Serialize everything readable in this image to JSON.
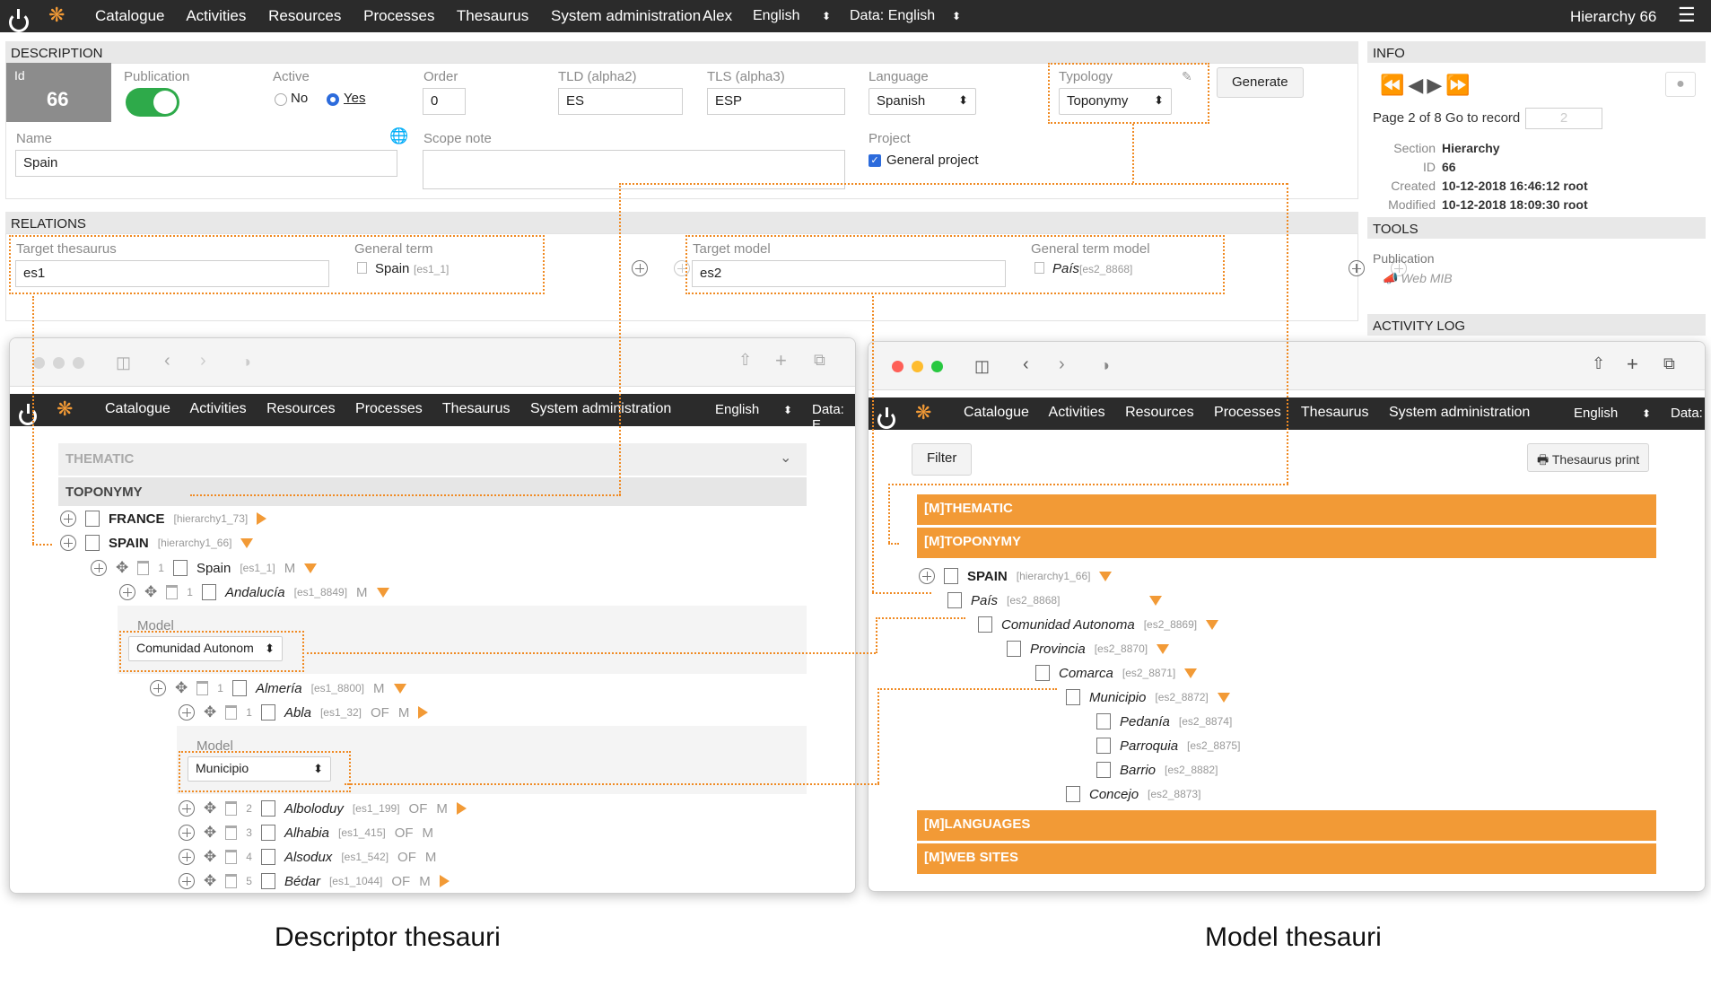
{
  "nav": {
    "menu": [
      "Catalogue",
      "Activities",
      "Resources",
      "Processes",
      "Thesaurus",
      "System administration"
    ],
    "user": "Alex",
    "lang": "English",
    "data_lang": "Data: English",
    "right_title": "Hierarchy 66"
  },
  "description": {
    "header": "DESCRIPTION",
    "id_label": "Id",
    "id_value": "66",
    "publication_label": "Publication",
    "active_label": "Active",
    "active_no": "No",
    "active_yes": "Yes",
    "order_label": "Order",
    "order_value": "0",
    "tld_label": "TLD (alpha2)",
    "tld_value": "ES",
    "tls_label": "TLS (alpha3)",
    "tls_value": "ESP",
    "language_label": "Language",
    "language_value": "Spanish",
    "typology_label": "Typology",
    "typology_value": "Toponymy",
    "generate_label": "Generate",
    "name_label": "Name",
    "name_value": "Spain",
    "scope_label": "Scope note",
    "project_label": "Project",
    "project_value": "General project"
  },
  "relations": {
    "header": "RELATIONS",
    "target_thesaurus_label": "Target thesaurus",
    "target_thesaurus_value": "es1",
    "general_term_label": "General term",
    "general_term_value": "Spain",
    "general_term_code": "[es1_1]",
    "target_model_label": "Target model",
    "target_model_value": "es2",
    "general_term_model_label": "General term model",
    "general_term_model_value": "País",
    "general_term_model_code": "[es2_8868]"
  },
  "info": {
    "header": "INFO",
    "page_text": "Page 2 of 8 Go to record",
    "record_placeholder": "2",
    "section_label": "Section",
    "section_value": "Hierarchy",
    "id_label": "ID",
    "id_value": "66",
    "created_label": "Created",
    "created_value": "10-12-2018 16:46:12 root",
    "modified_label": "Modified",
    "modified_value": "10-12-2018 18:09:30 root",
    "tools_header": "TOOLS",
    "publication_label": "Publication",
    "web_mib": "Web MIB",
    "activity_header": "ACTIVITY LOG"
  },
  "left_window": {
    "nav_menu": [
      "Catalogue",
      "Activities",
      "Resources",
      "Processes",
      "Thesaurus",
      "System administration"
    ],
    "nav_lang": "English",
    "nav_data": "Data: E",
    "thematic": "THEMATIC",
    "toponymy": "TOPONYMY",
    "rows": [
      {
        "name": "FRANCE",
        "code": "[hierarchy1_73]"
      },
      {
        "name": "SPAIN",
        "code": "[hierarchy1_66]"
      },
      {
        "num": "1",
        "name": "Spain",
        "code": "[es1_1]",
        "m": "M"
      },
      {
        "num": "1",
        "name": "Andalucía",
        "code": "[es1_8849]",
        "m": "M"
      },
      {
        "num": "1",
        "name": "Almería",
        "code": "[es1_8800]",
        "m": "M"
      },
      {
        "num": "1",
        "name": "Abla",
        "code": "[es1_32]",
        "of": "OF",
        "m": "M"
      },
      {
        "num": "2",
        "name": "Alboloduy",
        "code": "[es1_199]",
        "of": "OF",
        "m": "M"
      },
      {
        "num": "3",
        "name": "Alhabia",
        "code": "[es1_415]",
        "of": "OF",
        "m": "M"
      },
      {
        "num": "4",
        "name": "Alsodux",
        "code": "[es1_542]",
        "of": "OF",
        "m": "M"
      },
      {
        "num": "5",
        "name": "Bédar",
        "code": "[es1_1044]",
        "of": "OF",
        "m": "M"
      }
    ],
    "model_label": "Model",
    "model1_value": "Comunidad Autonom",
    "model2_value": "Municipio"
  },
  "right_window": {
    "nav_menu": [
      "Catalogue",
      "Activities",
      "Resources",
      "Processes",
      "Thesaurus",
      "System administration"
    ],
    "nav_lang": "English",
    "nav_data": "Data:",
    "filter": "Filter",
    "print": "Thesaurus print",
    "bars": [
      "[M]THEMATIC",
      "[M]TOPONYMY",
      "[M]LANGUAGES",
      "[M]WEB SITES"
    ],
    "tree": [
      {
        "name": "SPAIN",
        "code": "[hierarchy1_66]"
      },
      {
        "name": "País",
        "code": "[es2_8868]"
      },
      {
        "name": "Comunidad Autonoma",
        "code": "[es2_8869]"
      },
      {
        "name": "Provincia",
        "code": "[es2_8870]"
      },
      {
        "name": "Comarca",
        "code": "[es2_8871]"
      },
      {
        "name": "Municipio",
        "code": "[es2_8872]"
      },
      {
        "name": "Pedanía",
        "code": "[es2_8874]"
      },
      {
        "name": "Parroquia",
        "code": "[es2_8875]"
      },
      {
        "name": "Barrio",
        "code": "[es2_8882]"
      },
      {
        "name": "Concejo",
        "code": "[es2_8873]"
      }
    ]
  },
  "captions": {
    "left": "Descriptor thesauri",
    "right": "Model thesauri"
  },
  "colors": {
    "accent": "#f29a36",
    "navbar": "#2b2b2b",
    "toggle": "#2eaa4a"
  }
}
